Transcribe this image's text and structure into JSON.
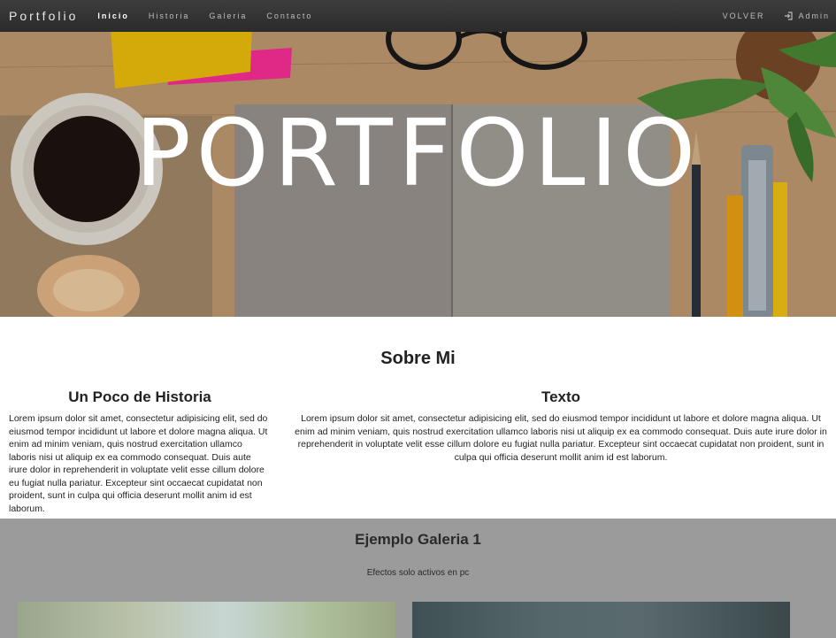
{
  "nav": {
    "brand": "Portfolio",
    "links": [
      "Inicio",
      "Historia",
      "Galeria",
      "Contacto"
    ],
    "active": "Inicio",
    "volver": "VOLVER",
    "admin": "Admin"
  },
  "hero": {
    "title": "PORTFOLIO"
  },
  "about": {
    "title": "Sobre Mi",
    "left": {
      "heading": "Un Poco de Historia",
      "text": "Lorem ipsum dolor sit amet, consectetur adipisicing elit, sed do eiusmod tempor incididunt ut labore et dolore magna aliqua. Ut enim ad minim veniam, quis nostrud exercitation ullamco laboris nisi ut aliquip ex ea commodo consequat. Duis aute irure dolor in reprehenderit in voluptate velit esse cillum dolore eu fugiat nulla pariatur. Excepteur sint occaecat cupidatat non proident, sunt in culpa qui officia deserunt mollit anim id est laborum."
    },
    "right": {
      "heading": "Texto",
      "text": "Lorem ipsum dolor sit amet, consectetur adipisicing elit, sed do eiusmod tempor incididunt ut labore et dolore magna aliqua. Ut enim ad minim veniam, quis nostrud exercitation ullamco laboris nisi ut aliquip ex ea commodo consequat. Duis aute irure dolor in reprehenderit in voluptate velit esse cillum dolore eu fugiat nulla pariatur. Excepteur sint occaecat cupidatat non proident, sunt in culpa qui officia deserunt mollit anim id est laborum."
    }
  },
  "gallery": {
    "title": "Ejemplo Galeria 1",
    "subtitle": "Efectos solo activos en pc"
  },
  "colors": {
    "navbar": "#333333",
    "gallery_bg": "#9b9b9b"
  },
  "icons": {
    "admin": "sign-in-icon"
  }
}
